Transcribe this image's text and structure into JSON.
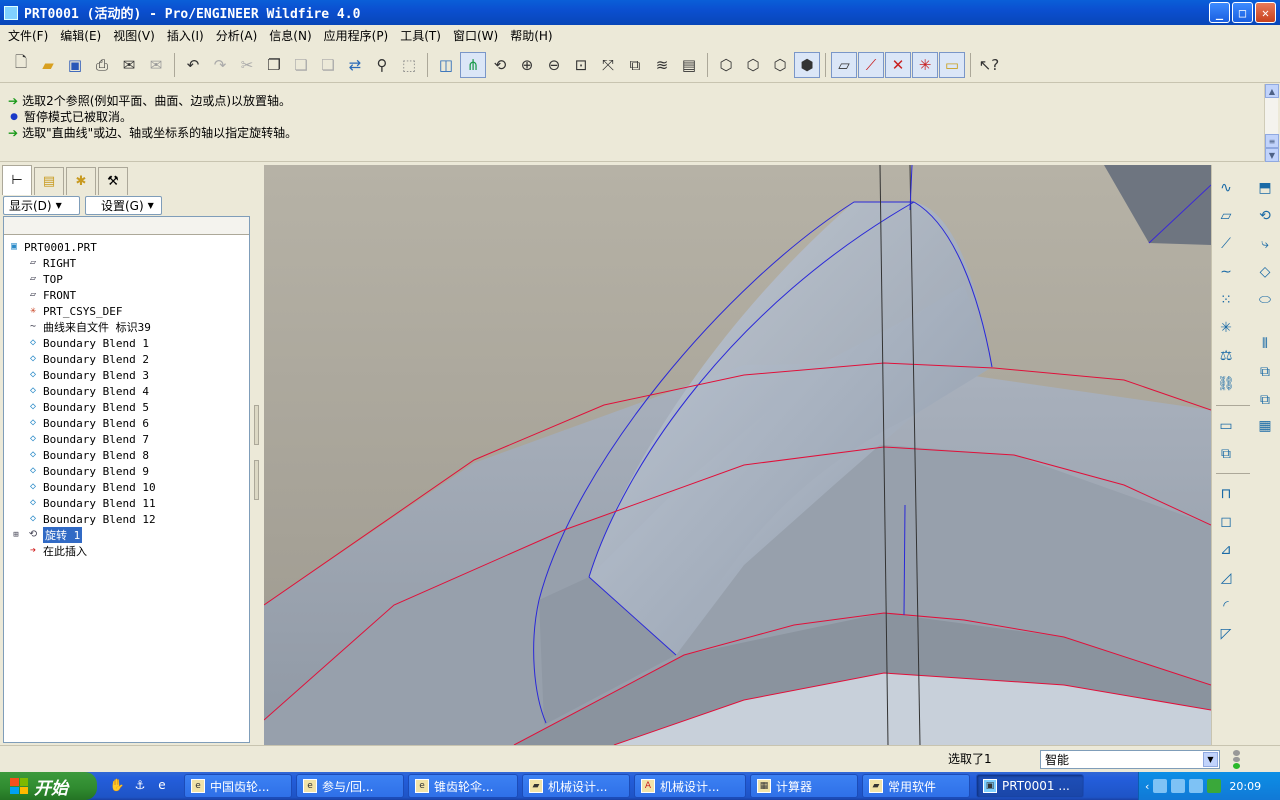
{
  "window": {
    "title": "PRT0001 (活动的) - Pro/ENGINEER Wildfire 4.0",
    "buttons": {
      "minimize": "_",
      "maximize": "□",
      "close": "✕"
    }
  },
  "menu": [
    "文件(F)",
    "编辑(E)",
    "视图(V)",
    "插入(I)",
    "分析(A)",
    "信息(N)",
    "应用程序(P)",
    "工具(T)",
    "窗口(W)",
    "帮助(H)"
  ],
  "messages": [
    {
      "icon": "green-arrow-icon",
      "text": "选取2个参照(例如平面、曲面、边或点)以放置轴。"
    },
    {
      "icon": "blue-dot-icon",
      "text": "暂停模式已被取消。"
    },
    {
      "icon": "green-arrow-icon",
      "text": "选取\"直曲线\"或边、轴或坐标系的轴以指定旋转轴。"
    }
  ],
  "navigator": {
    "show_label": "显示(D)",
    "settings_label": "设置(G)",
    "tree": [
      {
        "label": "PRT0001.PRT",
        "icon": "part-icon"
      },
      {
        "label": "RIGHT",
        "icon": "datum-plane-icon"
      },
      {
        "label": "TOP",
        "icon": "datum-plane-icon"
      },
      {
        "label": "FRONT",
        "icon": "datum-plane-icon"
      },
      {
        "label": "PRT_CSYS_DEF",
        "icon": "csys-icon"
      },
      {
        "label": "曲线来自文件 标识39",
        "icon": "curve-icon"
      },
      {
        "label": "Boundary Blend 1",
        "icon": "boundary-blend-icon"
      },
      {
        "label": "Boundary Blend 2",
        "icon": "boundary-blend-icon"
      },
      {
        "label": "Boundary Blend 3",
        "icon": "boundary-blend-icon"
      },
      {
        "label": "Boundary Blend 4",
        "icon": "boundary-blend-icon"
      },
      {
        "label": "Boundary Blend 5",
        "icon": "boundary-blend-icon"
      },
      {
        "label": "Boundary Blend 6",
        "icon": "boundary-blend-icon"
      },
      {
        "label": "Boundary Blend 7",
        "icon": "boundary-blend-icon"
      },
      {
        "label": "Boundary Blend 8",
        "icon": "boundary-blend-icon"
      },
      {
        "label": "Boundary Blend 9",
        "icon": "boundary-blend-icon"
      },
      {
        "label": "Boundary Blend 10",
        "icon": "boundary-blend-icon"
      },
      {
        "label": "Boundary Blend 11",
        "icon": "boundary-blend-icon"
      },
      {
        "label": "Boundary Blend 12",
        "icon": "boundary-blend-icon"
      },
      {
        "label": "旋转 1",
        "icon": "revolve-icon",
        "selected": true
      },
      {
        "label": "在此插入",
        "icon": "insert-here-icon"
      }
    ]
  },
  "status": {
    "selection_text": "选取了1",
    "filter_value": "智能"
  },
  "taskbar": {
    "start_label": "开始",
    "tasks": [
      {
        "label": "中国齿轮..."
      },
      {
        "label": "参与/回..."
      },
      {
        "label": "锥齿轮伞..."
      },
      {
        "label": "机械设计..."
      },
      {
        "label": "机械设计..."
      },
      {
        "label": "计算器"
      },
      {
        "label": "常用软件"
      },
      {
        "label": "PRT0001 ..."
      }
    ],
    "clock": "20:09"
  },
  "colors": {
    "titlebar": "#0b4fd0",
    "surface": "#9fa8b4",
    "edge_red": "#e0103a",
    "edge_blue": "#1a28e0",
    "selection": "#316ac5"
  }
}
